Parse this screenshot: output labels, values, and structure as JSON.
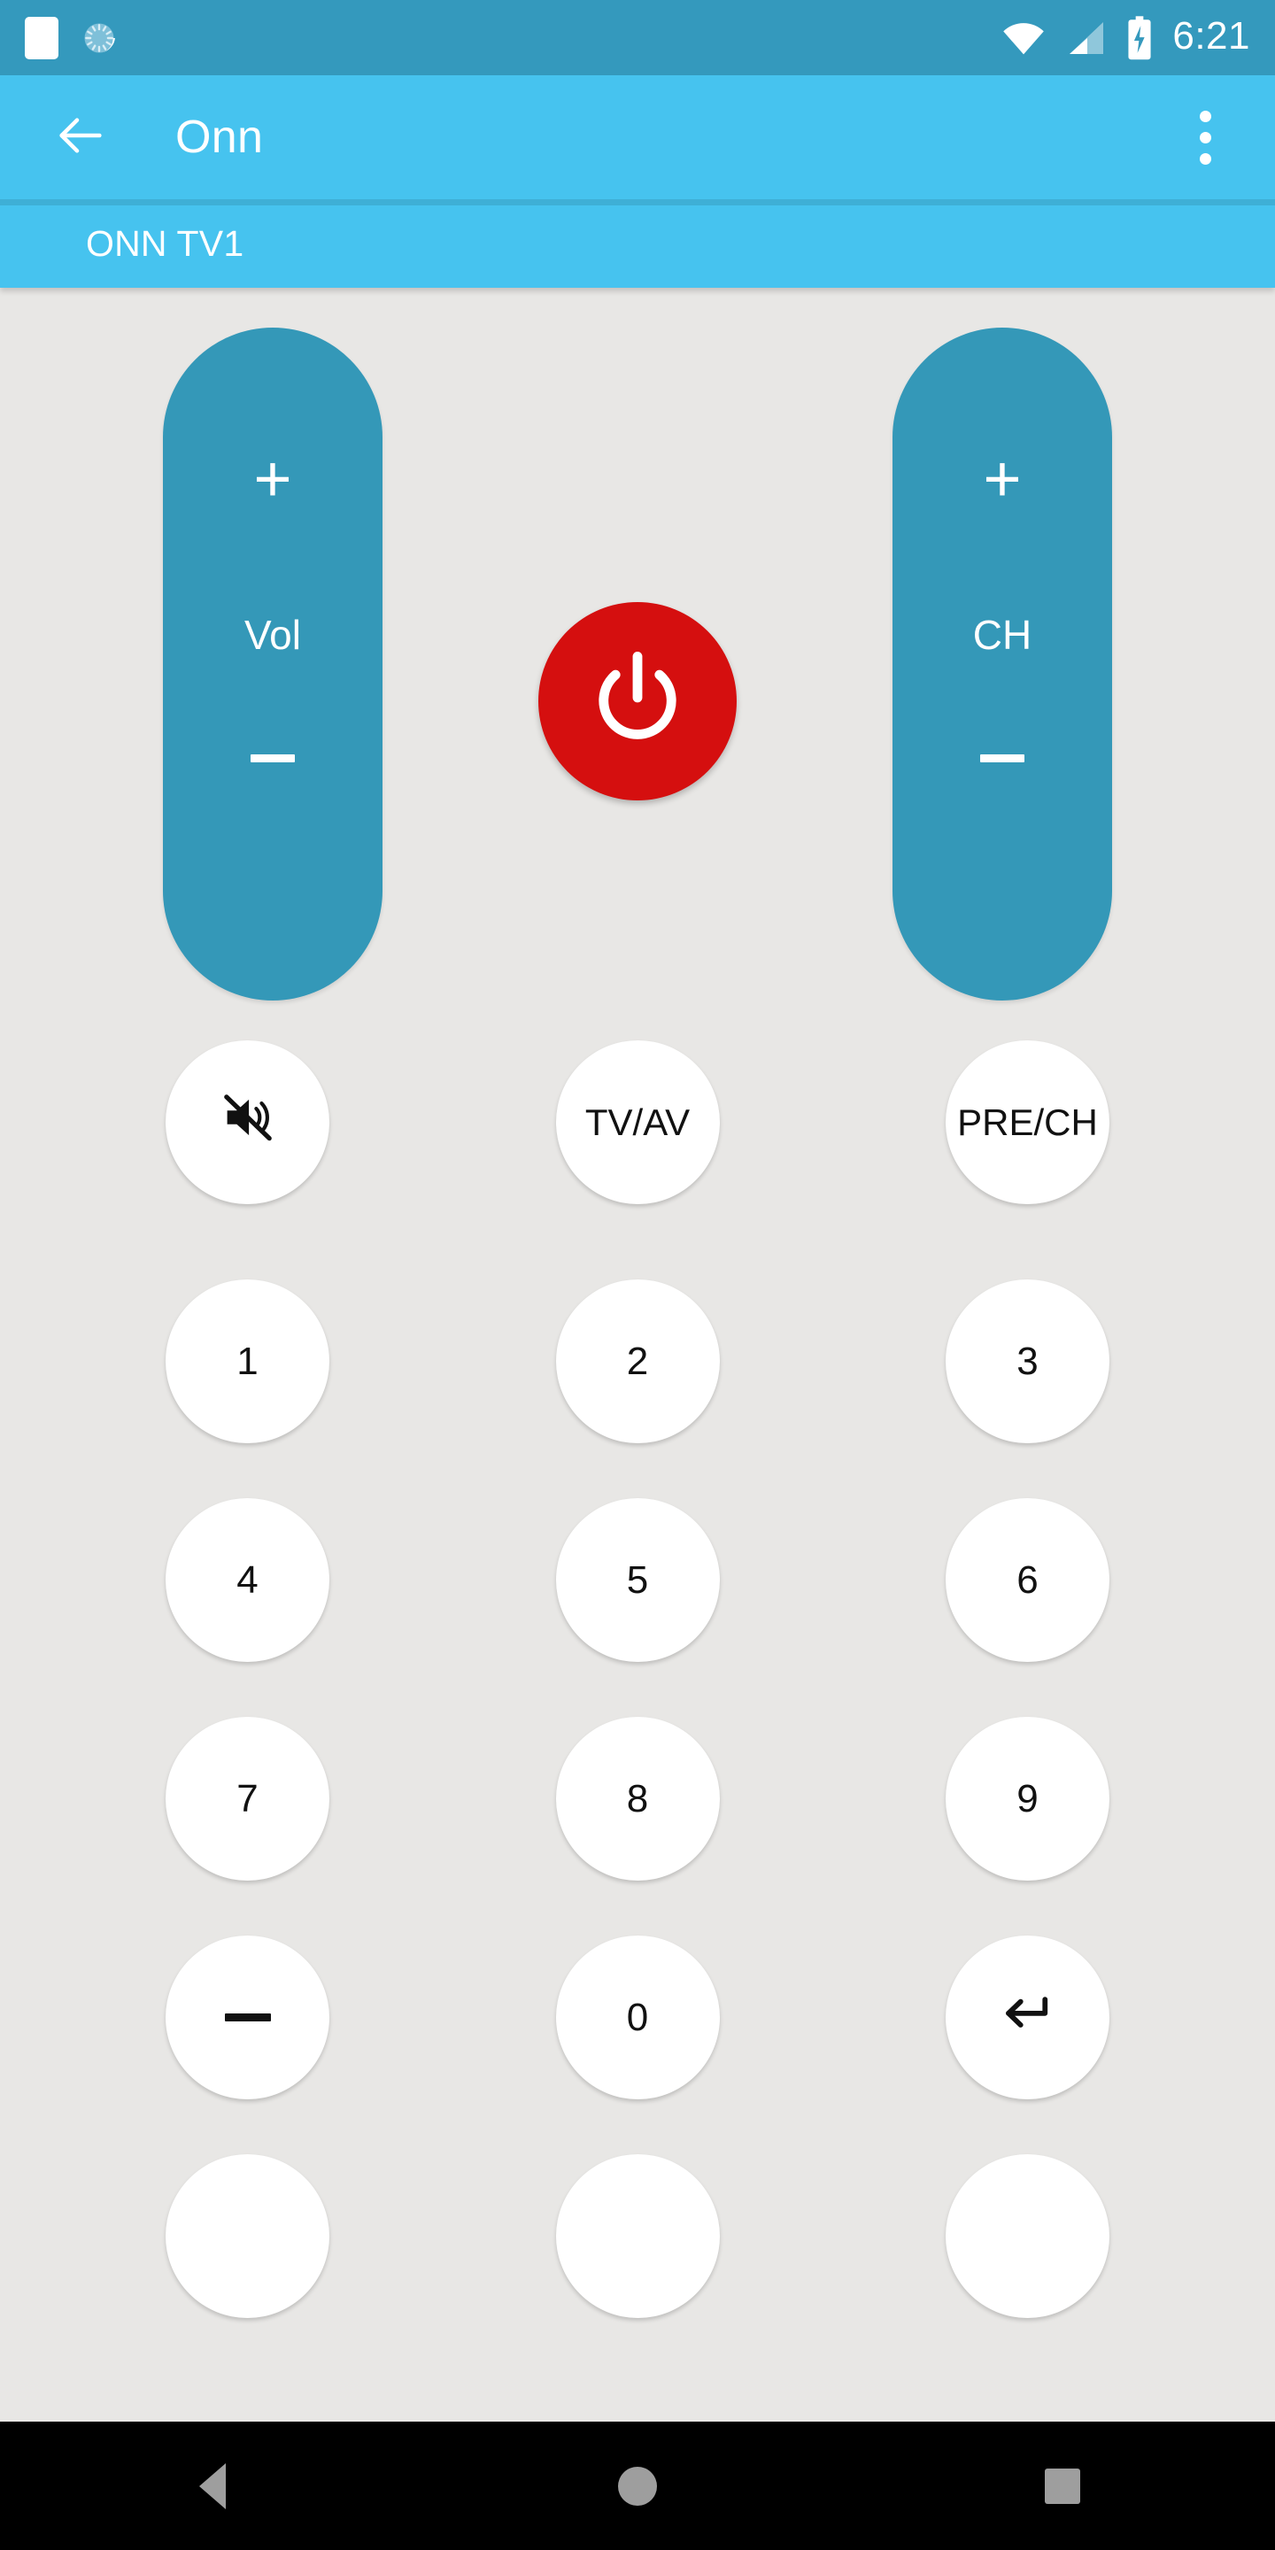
{
  "status_bar": {
    "background_color": "#3499bd",
    "notification_icons": [
      "notification-square-icon",
      "sync-spinner-icon"
    ],
    "wifi_icon": "wifi-icon",
    "signal_icon": "cellular-signal-icon",
    "battery_icon": "battery-charging-icon",
    "time": "6:21"
  },
  "app_bar": {
    "background_color": "#46c3ef",
    "back_icon": "back-arrow-icon",
    "title": "Onn",
    "overflow_icon": "overflow-menu-icon"
  },
  "subtitle_bar": {
    "device_name": "ONN TV1"
  },
  "remote": {
    "background_color": "#e8e7e5",
    "rocker_color": "#3498b8",
    "power_color": "#d50f0f",
    "volume_rocker": {
      "plus_label": "+",
      "label": "Vol",
      "minus_label": "−"
    },
    "channel_rocker": {
      "plus_label": "+",
      "label": "CH",
      "minus_label": "−"
    },
    "power_button": {
      "icon": "power-icon",
      "label": "Power"
    },
    "function_row": [
      {
        "key": "mute",
        "icon": "mute-icon",
        "label": ""
      },
      {
        "key": "tv_av",
        "icon": "",
        "label": "TV/AV"
      },
      {
        "key": "pre_ch",
        "icon": "",
        "label": "PRE/CH"
      }
    ],
    "keypad_rows": [
      [
        {
          "key": "1",
          "label": "1",
          "icon": ""
        },
        {
          "key": "2",
          "label": "2",
          "icon": ""
        },
        {
          "key": "3",
          "label": "3",
          "icon": ""
        }
      ],
      [
        {
          "key": "4",
          "label": "4",
          "icon": ""
        },
        {
          "key": "5",
          "label": "5",
          "icon": ""
        },
        {
          "key": "6",
          "label": "6",
          "icon": ""
        }
      ],
      [
        {
          "key": "7",
          "label": "7",
          "icon": ""
        },
        {
          "key": "8",
          "label": "8",
          "icon": ""
        },
        {
          "key": "9",
          "label": "9",
          "icon": ""
        }
      ],
      [
        {
          "key": "dash",
          "label": "",
          "icon": "dash-icon"
        },
        {
          "key": "0",
          "label": "0",
          "icon": ""
        },
        {
          "key": "enter",
          "label": "",
          "icon": "return-arrow-icon"
        }
      ]
    ],
    "partial_row": [
      {
        "key": "partial-1",
        "label": "",
        "icon": ""
      },
      {
        "key": "partial-2",
        "label": "",
        "icon": ""
      },
      {
        "key": "partial-3",
        "label": "",
        "icon": ""
      }
    ]
  },
  "nav_bar": {
    "background_color": "#000000",
    "back_label": "Back",
    "home_label": "Home",
    "recents_label": "Recents"
  }
}
